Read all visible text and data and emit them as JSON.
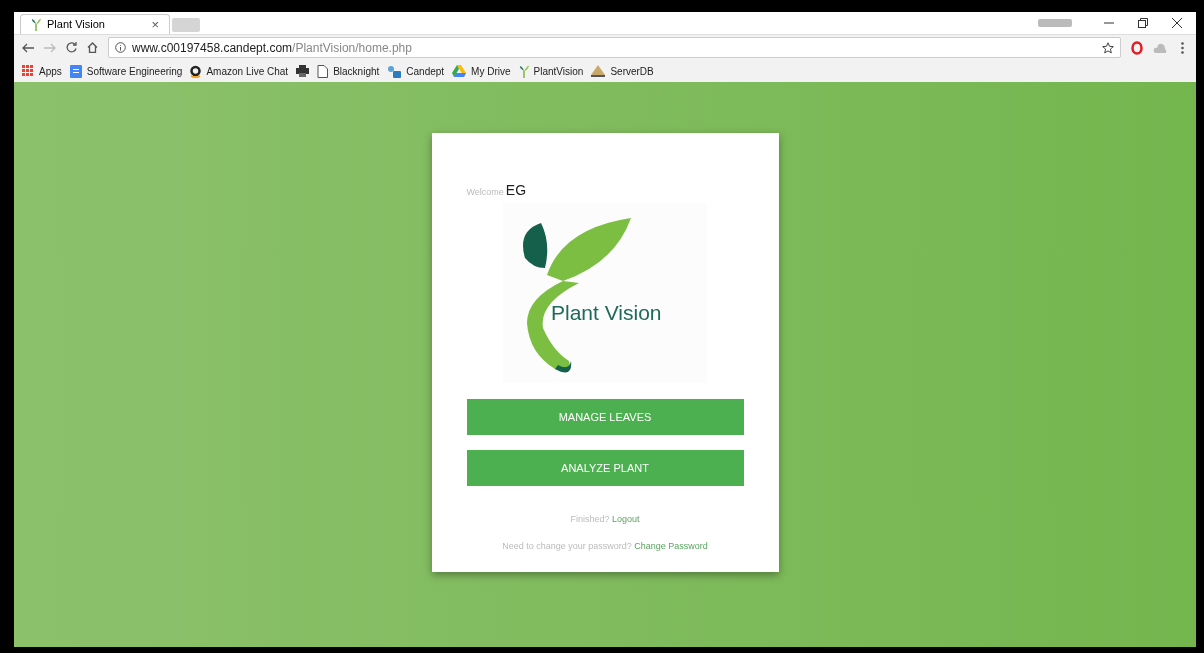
{
  "tabs": [
    {
      "title": "Plant Vision",
      "close": "×",
      "selected": true
    }
  ],
  "address": {
    "host": "www.c00197458.candept.com",
    "path": "/PlantVision/home.php"
  },
  "bookmarks": [
    {
      "label": "Apps",
      "kind": "apps"
    },
    {
      "label": "Software Engineering",
      "kind": "doc"
    },
    {
      "label": "Amazon Live Chat",
      "kind": "amazon"
    },
    {
      "kind": "printer"
    },
    {
      "label": "Blacknight",
      "kind": "page"
    },
    {
      "label": "Candept",
      "kind": "people"
    },
    {
      "label": "My Drive",
      "kind": "drive"
    },
    {
      "label": "PlantVision",
      "kind": "sprout"
    },
    {
      "label": "ServerDB",
      "kind": "server"
    }
  ],
  "card": {
    "welcome": "Welcome",
    "user": "EG",
    "logo_text": "Plant Vision",
    "buttons": [
      "MANAGE LEAVES",
      "ANALYZE PLANT"
    ],
    "links": [
      {
        "prefix": "Finished?",
        "link": "Logout"
      },
      {
        "prefix": "Need to change your password?",
        "link": "Change Password"
      }
    ]
  }
}
